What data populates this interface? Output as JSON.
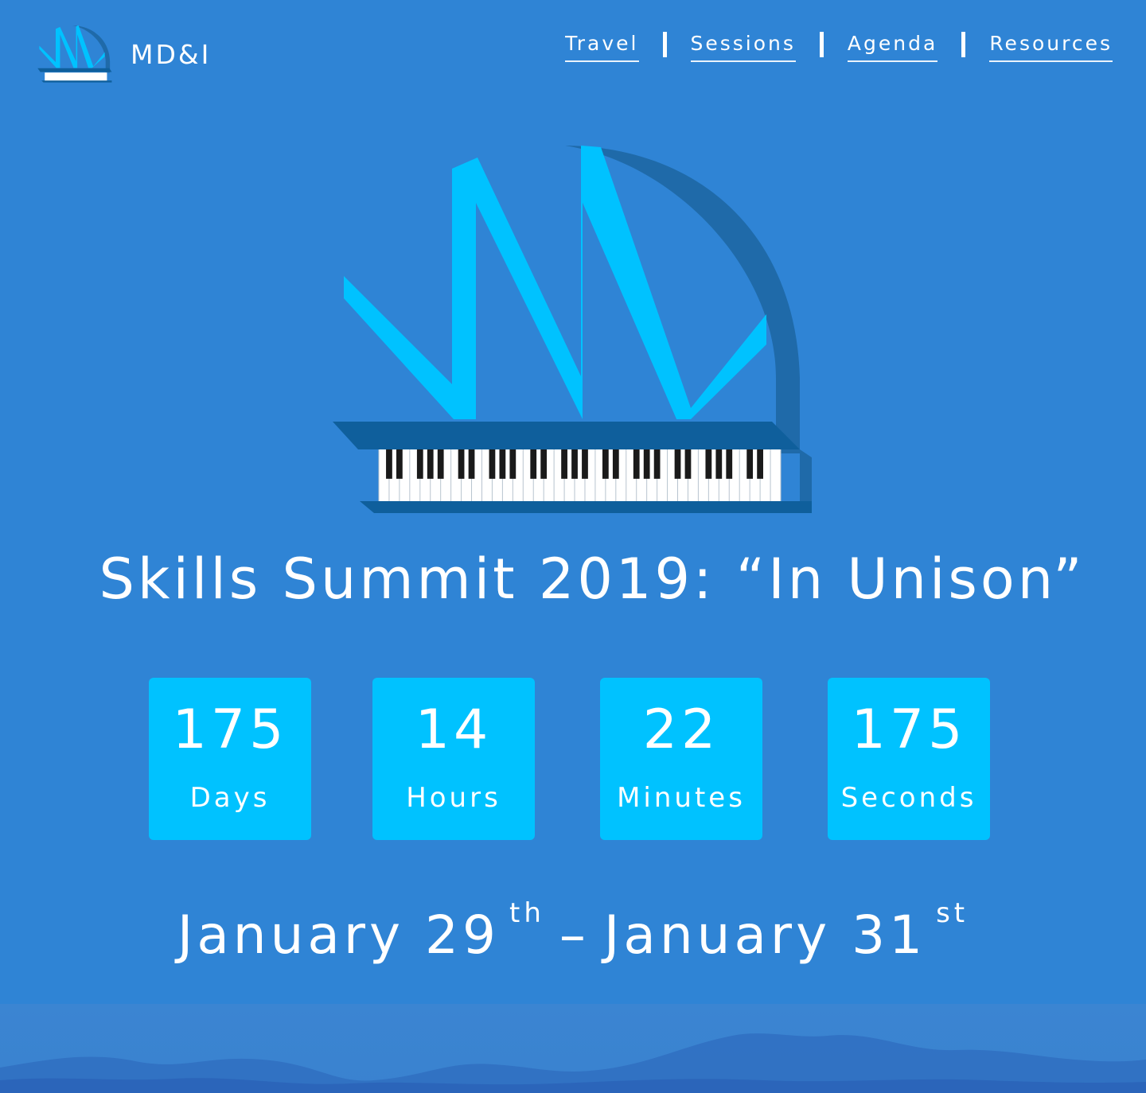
{
  "header": {
    "brand_name": "MD&I",
    "nav": [
      {
        "label": "Travel"
      },
      {
        "label": "Sessions"
      },
      {
        "label": "Agenda"
      },
      {
        "label": "Resources"
      }
    ]
  },
  "hero": {
    "title": "Skills Summit 2019: “In Unison”"
  },
  "countdown": [
    {
      "value": "175",
      "unit": "Days"
    },
    {
      "value": "14",
      "unit": "Hours"
    },
    {
      "value": "22",
      "unit": "Minutes"
    },
    {
      "value": "175",
      "unit": "Seconds"
    }
  ],
  "dates": {
    "start": "January 29",
    "start_suffix": "th",
    "separator": "–",
    "end": "January 31",
    "end_suffix": "st"
  },
  "colors": {
    "background": "#2f84d5",
    "countdown_box": "#00c2ff",
    "logo_accent": "#00c2ff",
    "logo_dark": "#0f5f9c",
    "logo_shadow": "#1f6aa9"
  }
}
